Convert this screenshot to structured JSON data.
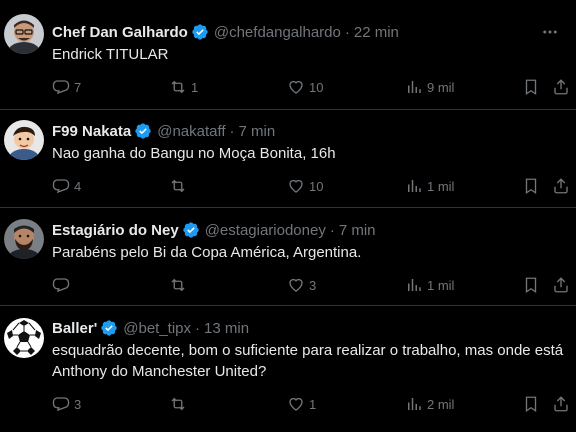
{
  "tweets": [
    {
      "name": "Chef Dan Galhardo",
      "handle": "@chefdangalhardo",
      "separator": "·",
      "time": "22 min",
      "text": "Endrick TITULAR",
      "replies": "7",
      "retweets": "1",
      "likes": "10",
      "views": "9 mil",
      "avatar": "man-with-glasses-avatar"
    },
    {
      "name": "F99 Nakata",
      "handle": "@nakataff",
      "separator": "·",
      "time": "7 min",
      "text": "Nao ganha do Bangu no Moça Bonita, 16h",
      "replies": "4",
      "retweets": "",
      "likes": "10",
      "views": "1 mil",
      "avatar": "cartoon-man-avatar"
    },
    {
      "name": "Estagiário do Ney",
      "handle": "@estagiariodoney",
      "separator": "·",
      "time": "7 min",
      "text": "Parabéns pelo Bi da Copa América, Argentina.",
      "replies": "",
      "retweets": "",
      "likes": "3",
      "views": "1 mil",
      "avatar": "bearded-man-avatar"
    },
    {
      "name": "Baller'",
      "handle": "@bet_tipx",
      "separator": "·",
      "time": "13 min",
      "text": "esquadrão decente, bom o suficiente para realizar o trabalho, mas onde está Anthony do Manchester United?",
      "replies": "3",
      "retweets": "",
      "likes": "1",
      "views": "2 mil",
      "avatar": "soccer-ball-avatar"
    }
  ],
  "colors": {
    "background": "#000000",
    "text": "#e7e9ea",
    "muted": "#71767b",
    "verified": "#1d9bf0",
    "divider": "#2f3336"
  }
}
